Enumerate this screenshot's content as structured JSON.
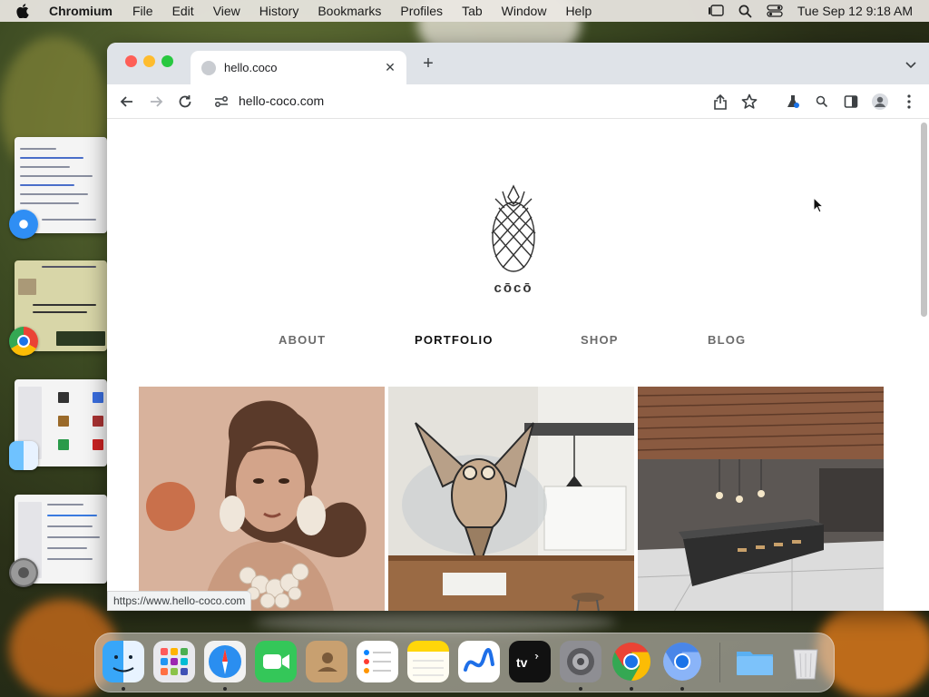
{
  "menubar": {
    "app_name": "Chromium",
    "items": [
      "File",
      "Edit",
      "View",
      "History",
      "Bookmarks",
      "Profiles",
      "Tab",
      "Window",
      "Help"
    ],
    "datetime": "Tue Sep 12  9:18 AM"
  },
  "browser": {
    "tab_title": "hello.coco",
    "url": "hello-coco.com",
    "status_url": "https://www.hello-coco.com"
  },
  "site": {
    "brand": "cōcō",
    "nav": [
      {
        "label": "ABOUT",
        "active": false
      },
      {
        "label": "PORTFOLIO",
        "active": true
      },
      {
        "label": "SHOP",
        "active": false
      },
      {
        "label": "BLOG",
        "active": false
      }
    ],
    "tiles": [
      "portrait-illustration",
      "owl-mural-cafe",
      "restaurant-interior-render"
    ]
  },
  "dock": {
    "apps": [
      "finder-icon",
      "launchpad-icon",
      "safari-icon",
      "facetime-icon",
      "contacts-icon",
      "reminders-icon",
      "notes-icon",
      "freeform-icon",
      "apple-tv-icon",
      "system-settings-icon",
      "chrome-icon",
      "chromium-icon",
      "folder-icon",
      "trash-icon"
    ],
    "colors": {
      "accent": "#1a73e8"
    }
  }
}
